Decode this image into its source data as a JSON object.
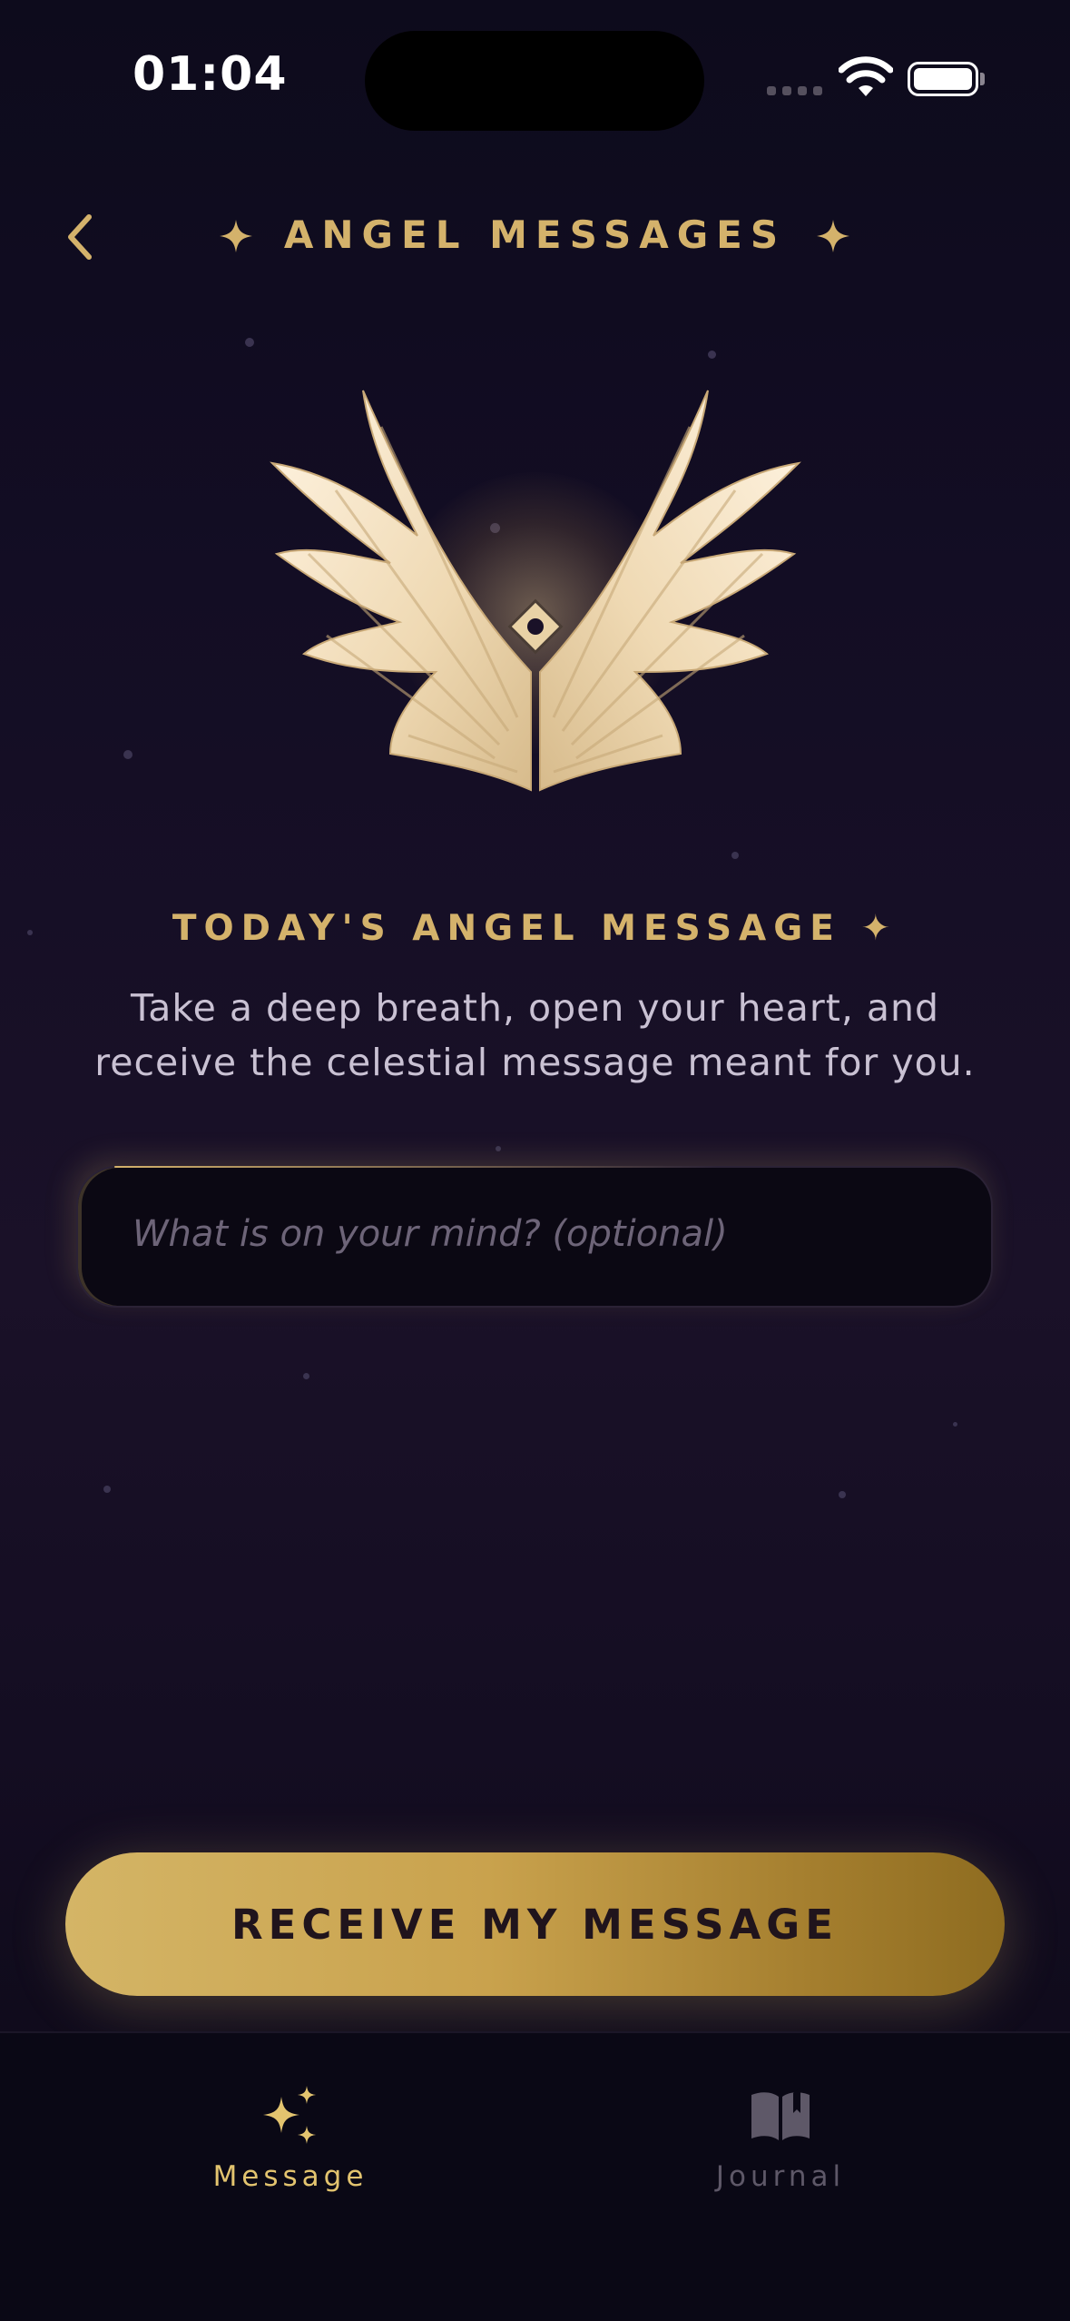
{
  "status_bar": {
    "time": "01:04",
    "signal_icon": "cellular-signal-icon",
    "wifi_icon": "wifi-icon",
    "battery_icon": "battery-icon"
  },
  "header": {
    "back_icon": "chevron-left-icon",
    "title": "ANGEL MESSAGES",
    "decor_icon": "sparkle-icon"
  },
  "hero": {
    "image": "angel-wings-icon"
  },
  "message_section": {
    "title": "TODAY'S ANGEL MESSAGE ✦",
    "subtitle": "Take a deep breath, open your heart, and receive the celestial message meant for you.",
    "input_placeholder": "What is on your mind? (optional)",
    "input_value": ""
  },
  "cta": {
    "label": "RECEIVE MY MESSAGE"
  },
  "tabbar": {
    "tabs": [
      {
        "label": "Message",
        "icon": "sparkles-icon",
        "active": true
      },
      {
        "label": "Journal",
        "icon": "open-book-icon",
        "active": false
      }
    ]
  },
  "colors": {
    "accent_gold": "#d4b26b",
    "background": "#130d24",
    "inactive_tab": "#5e5868"
  }
}
